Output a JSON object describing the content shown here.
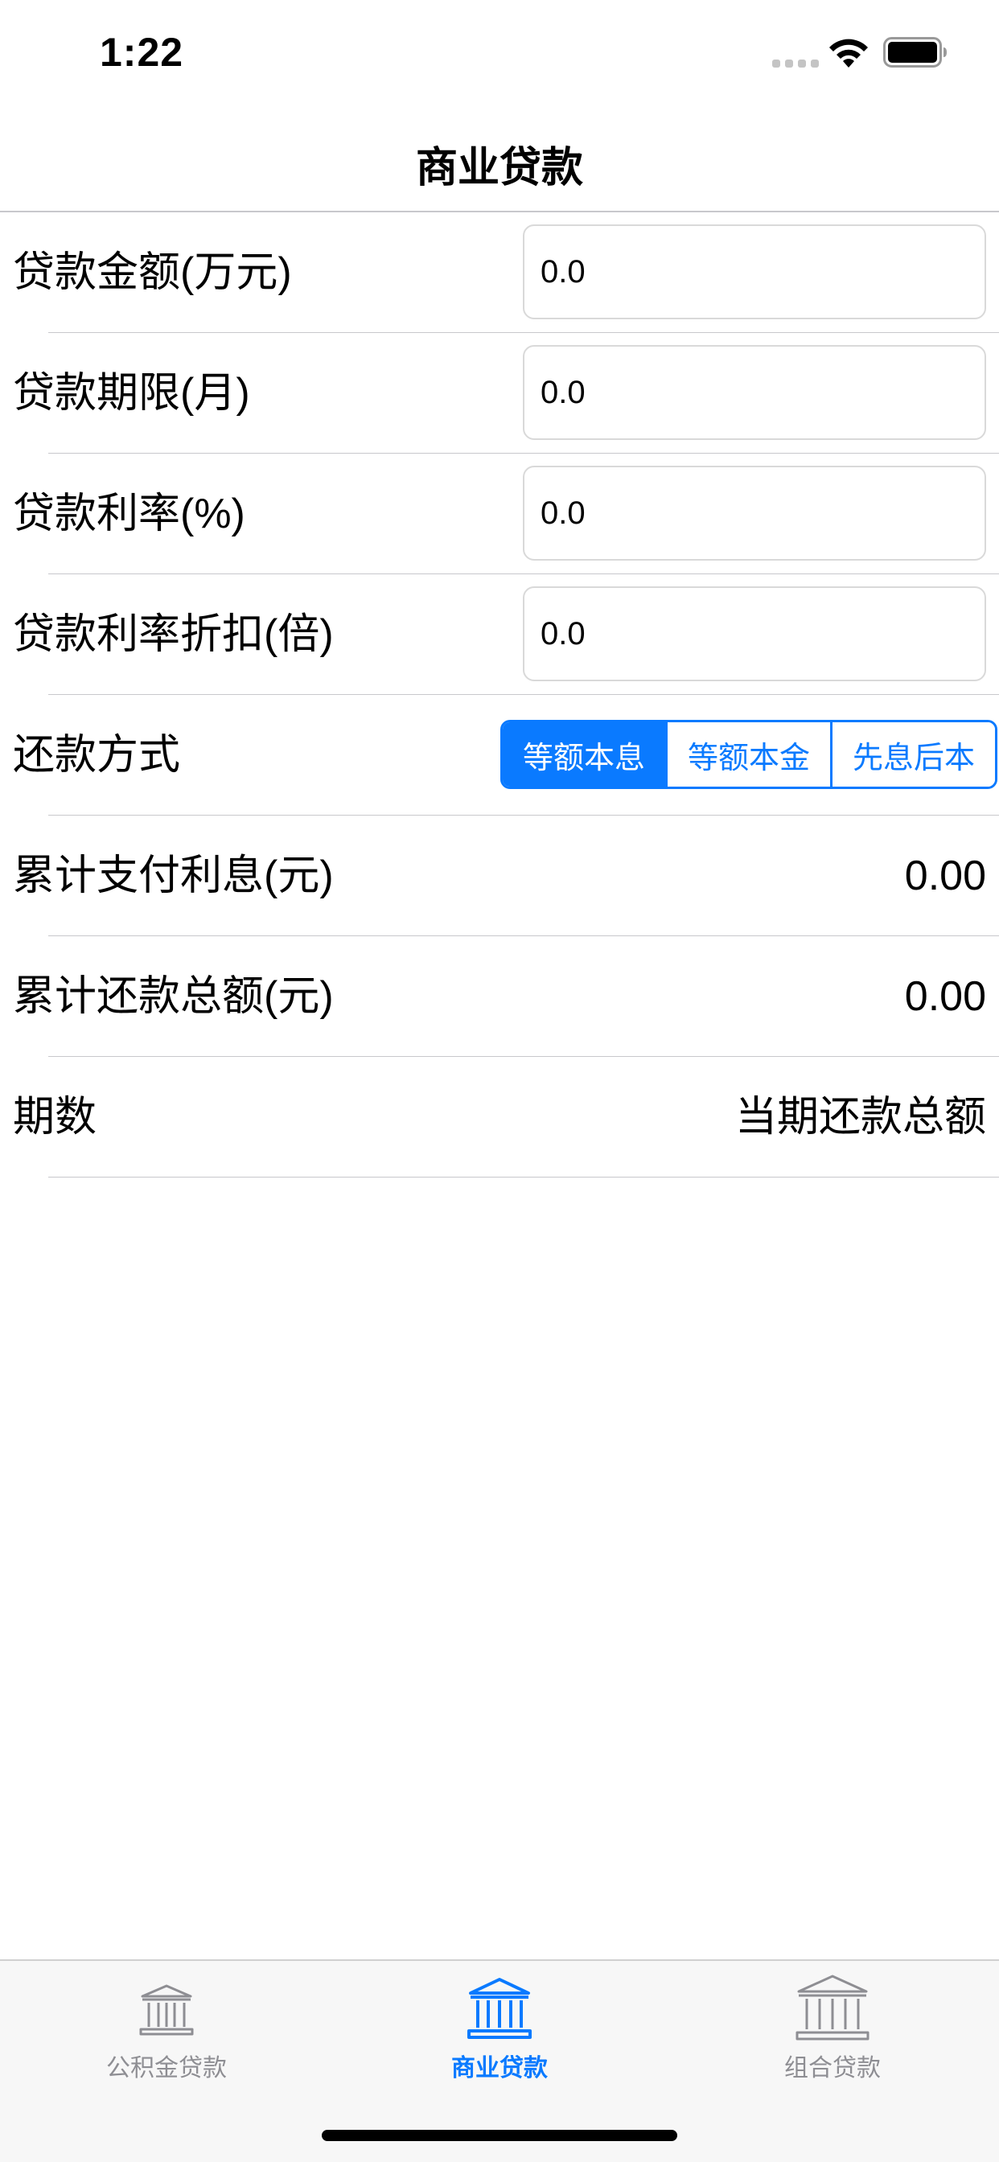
{
  "status_bar": {
    "time": "1:22"
  },
  "nav": {
    "title": "商业贷款"
  },
  "form": {
    "rows": [
      {
        "label": "贷款金额(万元)",
        "value": "0.0"
      },
      {
        "label": "贷款期限(月)",
        "value": "0.0"
      },
      {
        "label": "贷款利率(%)",
        "value": "0.0"
      },
      {
        "label": "贷款利率折扣(倍)",
        "value": "0.0"
      }
    ],
    "repayment": {
      "label": "还款方式",
      "options": [
        "等额本息",
        "等额本金",
        "先息后本"
      ],
      "selected": "等额本息"
    },
    "total_interest": {
      "label": "累计支付利息(元)",
      "value": "0.00"
    },
    "total_repayment": {
      "label": "累计还款总额(元)",
      "value": "0.00"
    },
    "period_header": {
      "label": "期数",
      "value": "当期还款总额"
    }
  },
  "tab_bar": {
    "tabs": [
      {
        "label": "公积金贷款",
        "icon": "bank-icon",
        "active": false
      },
      {
        "label": "商业贷款",
        "icon": "bank-icon",
        "active": true
      },
      {
        "label": "组合贷款",
        "icon": "bank-icon",
        "active": false
      }
    ]
  },
  "colors": {
    "accent": "#0a7aff",
    "inactive": "#8e8e93",
    "separator": "#c8c8cc",
    "tab_bar_bg": "#f7f7f7"
  }
}
